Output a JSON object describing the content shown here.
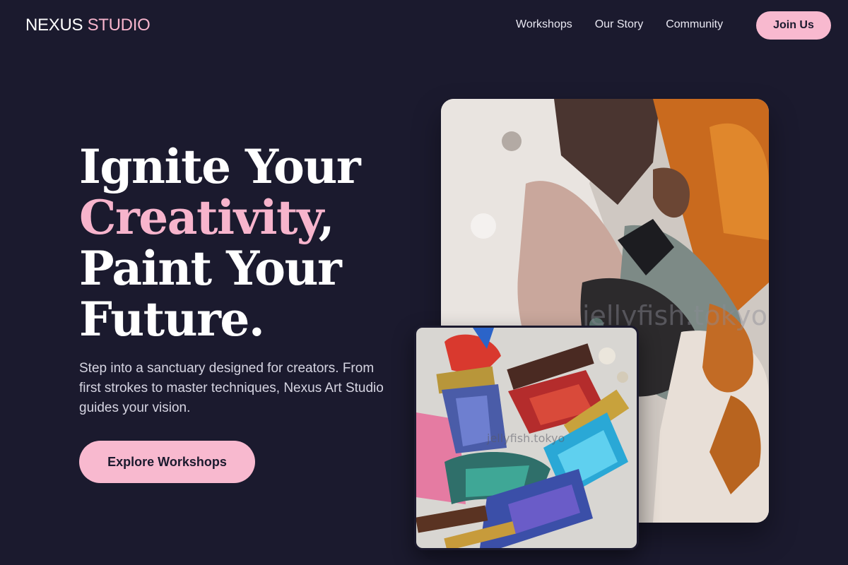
{
  "brand": {
    "part1": "NEXUS",
    "part2": "STUDIO"
  },
  "nav": {
    "items": [
      "Workshops",
      "Our Story",
      "Community"
    ],
    "join_label": "Join Us"
  },
  "hero": {
    "line1": "Ignite Your",
    "line2_accent": "Creativity",
    "line2_tail": ",",
    "line3": "Paint Your",
    "line4": "Future.",
    "subtext": "Step into a sanctuary designed for creators. From first strokes to master techniques, Nexus Art Studio guides your vision.",
    "cta_label": "Explore Workshops"
  },
  "images": {
    "large": {
      "watermark": "jellyfish.tokyo"
    },
    "small": {
      "watermark": "jellyfish.tokyo"
    }
  },
  "colors": {
    "background": "#1b1a2e",
    "accent": "#f8b9cf",
    "text": "#ffffff"
  }
}
